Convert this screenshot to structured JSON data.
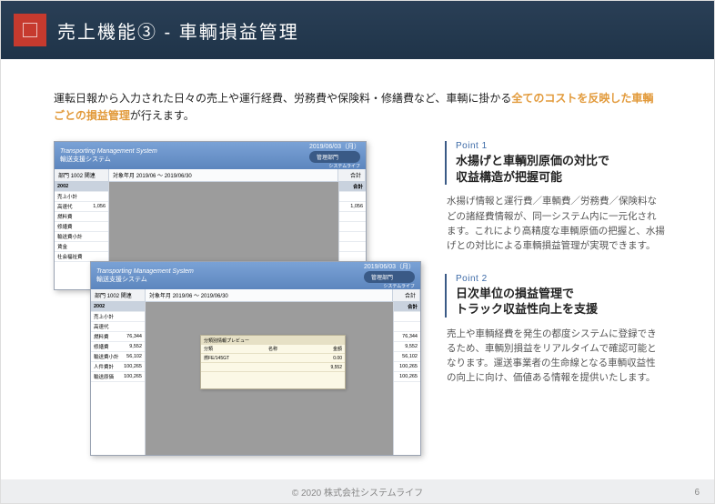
{
  "header": {
    "title": "売上機能③ - 車輌損益管理"
  },
  "intro": {
    "part1": "運転日報から入力された日々の売上や運行経費、労務費や保険料・修繕費など、車輌に掛かる",
    "highlight": "全てのコストを反映した車輌ごとの損益管理",
    "part2": "が行えます。"
  },
  "mock": {
    "app_title_left": "Transporting Management System",
    "app_title_sub": "輸送支援システム",
    "app_title_date": "2019/06/03（月）",
    "app_title_dept": "管理部門",
    "app_title_company": "システムライフ",
    "table": {
      "col_dept": "部門",
      "col_dept_val": "1002 関連",
      "col_period": "対象年月",
      "col_period_val": "2019/06  ～  2019/06/30",
      "col_sum": "合計"
    },
    "rows_back": [
      {
        "label": "2002",
        "val": ""
      },
      {
        "label": "売上小計",
        "val": ""
      },
      {
        "label": "高速代",
        "val": "1,056"
      },
      {
        "label": "燃料費",
        "val": ""
      },
      {
        "label": "修繕費",
        "val": ""
      },
      {
        "label": "輸送費小計",
        "val": ""
      },
      {
        "label": "賃金",
        "val": ""
      },
      {
        "label": "社会福祉費",
        "val": ""
      }
    ],
    "rows_back_right": [
      "",
      "合計",
      "",
      "1,056",
      "",
      "",
      "",
      "",
      ""
    ],
    "rows_front_left": [
      {
        "label": "2002",
        "val": ""
      },
      {
        "label": "売上小計",
        "val": ""
      },
      {
        "label": "高速代",
        "val": ""
      },
      {
        "label": "燃料費",
        "val": "76,344"
      },
      {
        "label": "修繕費",
        "val": "9,552"
      },
      {
        "label": "輸送費小計",
        "val": "56,102"
      },
      {
        "label": "人件費計",
        "val": "100,265"
      },
      {
        "label": "輸送原価",
        "val": "100,265"
      }
    ],
    "rows_front_right": [
      "",
      "合計",
      "",
      "",
      "76,344",
      "9,552",
      "56,102",
      "100,265",
      "100,265"
    ],
    "dialog": {
      "title": "分類別情報プレビュー",
      "rows": [
        {
          "c1": "分類",
          "c2": "名称",
          "c3": "金額"
        },
        {
          "c1": "燃FE/145GT",
          "c2": "",
          "c3": "0.00"
        },
        {
          "c1": "",
          "c2": "",
          "c3": "9,552"
        }
      ]
    }
  },
  "points": [
    {
      "tag": "Point 1",
      "title_l1": "水揚げと車輌別原価の対比で",
      "title_l2": "収益構造が把握可能",
      "body": "水揚げ情報と運行費／車輌費／労務費／保険料などの諸経費情報が、同一システム内に一元化されます。これにより高精度な車輌原価の把握と、水揚げとの対比による車輌損益管理が実現できます。"
    },
    {
      "tag": "Point 2",
      "title_l1": "日次単位の損益管理で",
      "title_l2": "トラック収益性向上を支援",
      "body": "売上や車輌経費を発生の都度システムに登録できるため、車輌別損益をリアルタイムで確認可能となります。運送事業者の生命線となる車輌収益性の向上に向け、価値ある情報を提供いたします。"
    }
  ],
  "footer": {
    "copyright": "© 2020  株式会社システムライフ",
    "page": "6"
  }
}
